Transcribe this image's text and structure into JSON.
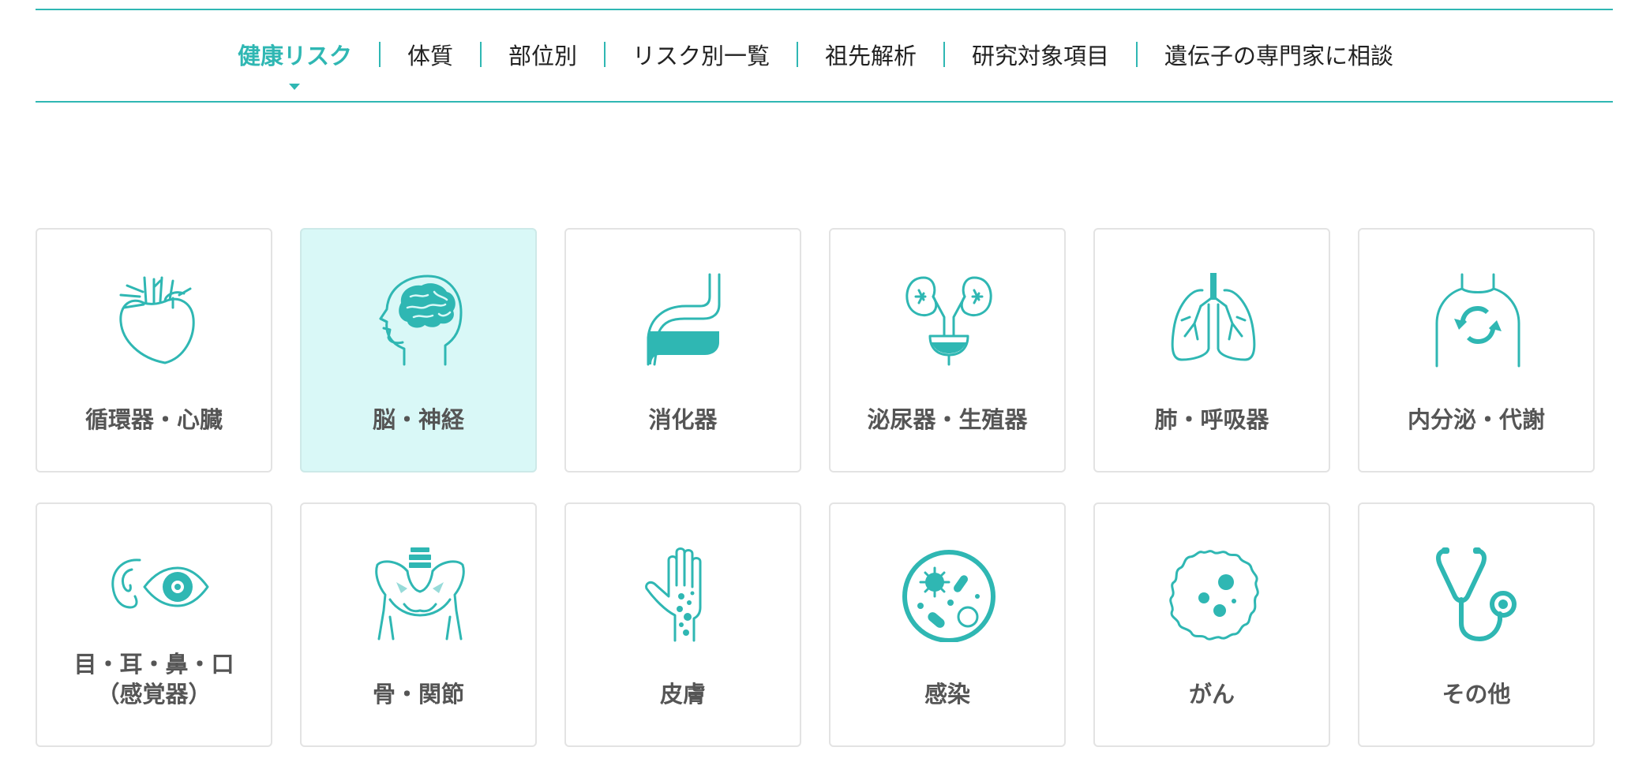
{
  "nav": {
    "items": [
      {
        "label": "健康リスク",
        "active": true
      },
      {
        "label": "体質"
      },
      {
        "label": "部位別"
      },
      {
        "label": "リスク別一覧"
      },
      {
        "label": "祖先解析"
      },
      {
        "label": "研究対象項目"
      },
      {
        "label": "遺伝子の専門家に相談"
      }
    ]
  },
  "categories": [
    {
      "label": "循環器・心臓",
      "icon": "heart-icon"
    },
    {
      "label": "脳・神経",
      "icon": "brain-head-icon",
      "selected": true
    },
    {
      "label": "消化器",
      "icon": "stomach-icon"
    },
    {
      "label": "泌尿器・生殖器",
      "icon": "kidney-icon"
    },
    {
      "label": "肺・呼吸器",
      "icon": "lungs-icon"
    },
    {
      "label": "内分泌・代謝",
      "icon": "metabolism-icon"
    },
    {
      "label": "目・耳・鼻・口",
      "label2": "（感覚器）",
      "icon": "eye-ear-icon"
    },
    {
      "label": "骨・関節",
      "icon": "pelvis-bone-icon"
    },
    {
      "label": "皮膚",
      "icon": "hand-skin-icon"
    },
    {
      "label": "感染",
      "icon": "microbe-icon"
    },
    {
      "label": "がん",
      "icon": "cancer-cell-icon"
    },
    {
      "label": "その他",
      "icon": "stethoscope-icon"
    }
  ],
  "colors": {
    "accent": "#2fb7b3",
    "selected_bg": "#d9f8f7"
  }
}
